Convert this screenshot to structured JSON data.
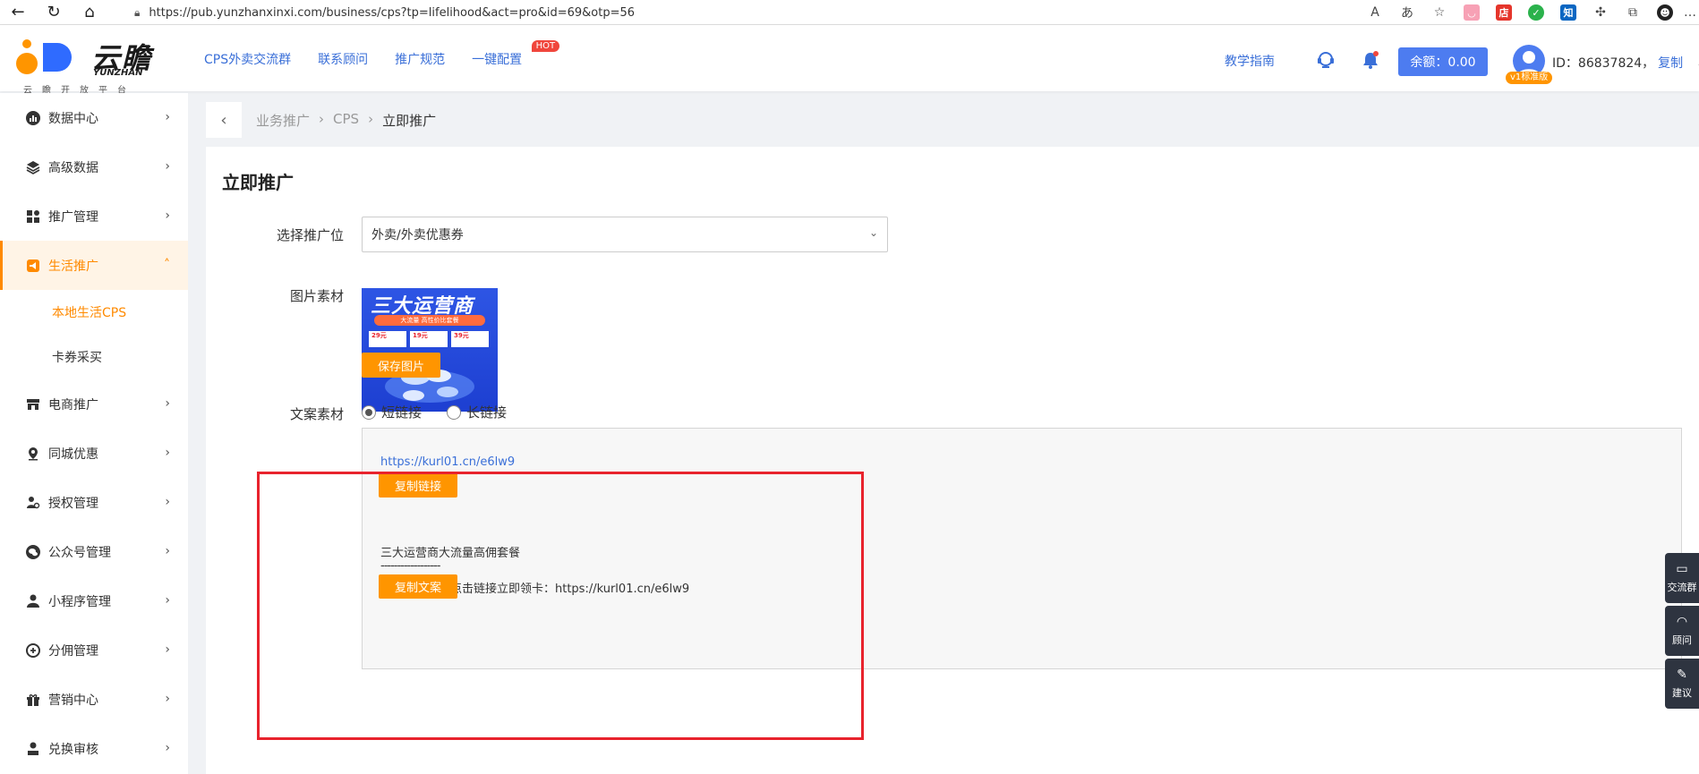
{
  "browser": {
    "url": "https://pub.yunzhanxinxi.com/business/cps?tp=lifelihood&act=pro&id=69&otp=56",
    "ext_labels": [
      "店",
      "知"
    ]
  },
  "header": {
    "logo_text": "云瞻",
    "logo_sub": "YUNZHAN",
    "logo_caption": "云瞻开放平台",
    "nav": [
      {
        "label": "CPS外卖交流群"
      },
      {
        "label": "联系顾问"
      },
      {
        "label": "推广规范"
      },
      {
        "label": "一键配置",
        "badge": "HOT"
      }
    ],
    "guide_label": "教学指南",
    "balance_label": "余额：0.00",
    "version_badge": "v1标准版",
    "user_id_text": "ID：86837824，",
    "copy_label": "复制"
  },
  "sidebar": {
    "items": [
      {
        "label": "数据中心",
        "icon": "chart-icon"
      },
      {
        "label": "高级数据",
        "icon": "layers-icon"
      },
      {
        "label": "推广管理",
        "icon": "grid-icon"
      },
      {
        "label": "生活推广",
        "icon": "megaphone-icon",
        "active": true
      },
      {
        "label": "电商推广",
        "icon": "store-icon"
      },
      {
        "label": "同城优惠",
        "icon": "location-icon"
      },
      {
        "label": "授权管理",
        "icon": "user-key-icon"
      },
      {
        "label": "公众号管理",
        "icon": "wechat-icon"
      },
      {
        "label": "小程序管理",
        "icon": "person-icon"
      },
      {
        "label": "分佣管理",
        "icon": "commission-icon"
      },
      {
        "label": "营销中心",
        "icon": "gift-icon"
      },
      {
        "label": "兑换审核",
        "icon": "audit-icon"
      }
    ],
    "sub_items": [
      {
        "label": "本地生活CPS",
        "current": true
      },
      {
        "label": "卡券采买"
      }
    ]
  },
  "breadcrumb": {
    "items": [
      "业务推广",
      "CPS",
      "立即推广"
    ],
    "separator": "›"
  },
  "main": {
    "title": "立即推广",
    "position_label": "选择推广位",
    "position_value": "外卖/外卖优惠券",
    "image_label": "图片素材",
    "poster": {
      "headline": "三大运营商",
      "banner": "大流量 高性价比套餐",
      "prices": [
        "29元",
        "19元",
        "39元"
      ]
    },
    "save_image_label": "保存图片",
    "copy_label": "文案素材",
    "radio_short": "短链接",
    "radio_long": "长链接",
    "short_selected": true,
    "link": "https://kurl01.cn/e6lw9",
    "copy_link_label": "复制链接",
    "text_line1": "三大运营商大流量高佣套餐",
    "text_line2": "------------------",
    "text_line3": "【立即领卡】点击链接立即领卡：https://kurl01.cn/e6lw9",
    "copy_text_label": "复制文案"
  },
  "float_tools": [
    {
      "label": "交流群",
      "icon": "chat-icon"
    },
    {
      "label": "顾问",
      "icon": "headset-icon"
    },
    {
      "label": "建议",
      "icon": "edit-icon"
    }
  ],
  "colors": {
    "accent_orange": "#ff9500",
    "brand_blue": "#4d7cf0",
    "link_blue": "#3a6fd8",
    "highlight_red": "#e8232d"
  }
}
